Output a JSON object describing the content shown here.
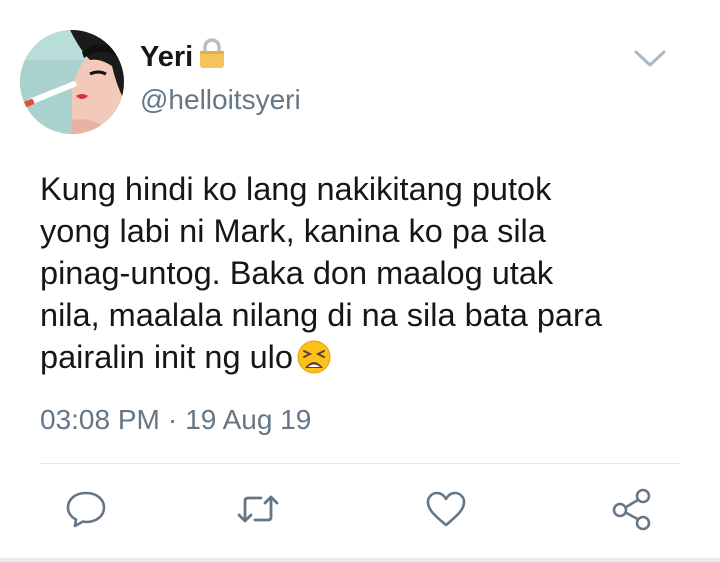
{
  "user": {
    "display_name": "Yeri",
    "handle": "@helloitsyeri",
    "protected": true
  },
  "tweet": {
    "lines": [
      "Kung hindi ko lang nakikitang putok",
      "yong labi ni Mark, kanina ko pa sila",
      "pinag-untog. Baka don maalog utak",
      "nila, maalala nilang di na sila bata para",
      "pairalin init ng ulo"
    ],
    "emoji": "weary-face"
  },
  "meta": {
    "time": "03:08 PM",
    "separator": "·",
    "date": "19 Aug 19"
  },
  "actions": [
    "reply-icon",
    "retweet-icon",
    "like-icon",
    "share-icon"
  ],
  "colors": {
    "text": "#14171a",
    "secondary": "#657786",
    "icon": "#657786",
    "divider": "#e1e8ed",
    "lock": "#f5c25c"
  }
}
